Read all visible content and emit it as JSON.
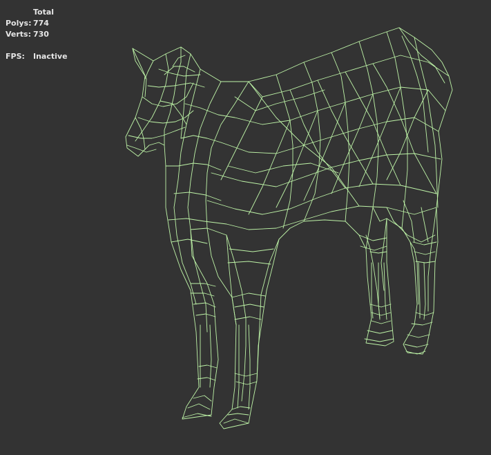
{
  "hud": {
    "header": "Total",
    "polys_label": "Polys:",
    "polys_value": "774",
    "verts_label": "Verts:",
    "verts_value": "730",
    "fps_label": "FPS:",
    "fps_value": "Inactive"
  },
  "viewport": {
    "background_color": "#333333",
    "wire_color": "#bff5a8",
    "model": "horse-wireframe"
  }
}
